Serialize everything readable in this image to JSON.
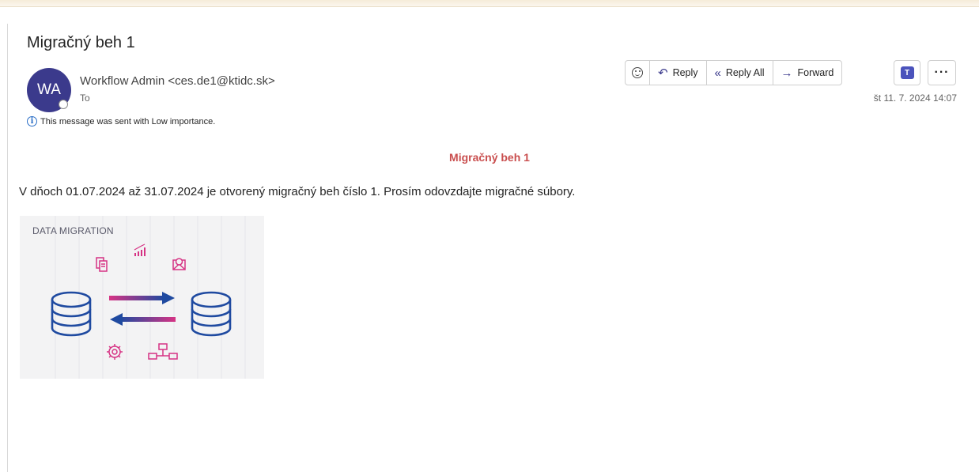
{
  "email": {
    "subject": "Migračný beh 1",
    "avatar_initials": "WA",
    "sender": "Workflow Admin <ces.de1@ktidc.sk>",
    "to_label": "To",
    "importance_notice": "This message was sent with Low importance.",
    "date": "št 11. 7. 2024 14:07"
  },
  "toolbar": {
    "reply_label": "Reply",
    "reply_all_label": "Reply All",
    "forward_label": "Forward",
    "icons": [
      "emoji-icon",
      "reply-icon",
      "reply-all-icon",
      "forward-icon",
      "teams-icon",
      "more-icon"
    ]
  },
  "body": {
    "heading": "Migračný beh 1",
    "text": "V dňoch 01.07.2024 až 31.07.2024 je otvorený migračný beh číslo 1. Prosím odovzdajte migračné súbory.",
    "image_title": "DATA MIGRATION"
  },
  "colors": {
    "heading": "#c94e4e",
    "avatar": "#3b3a8c",
    "image_pink": "#d63384",
    "image_blue": "#1f4aa0"
  }
}
